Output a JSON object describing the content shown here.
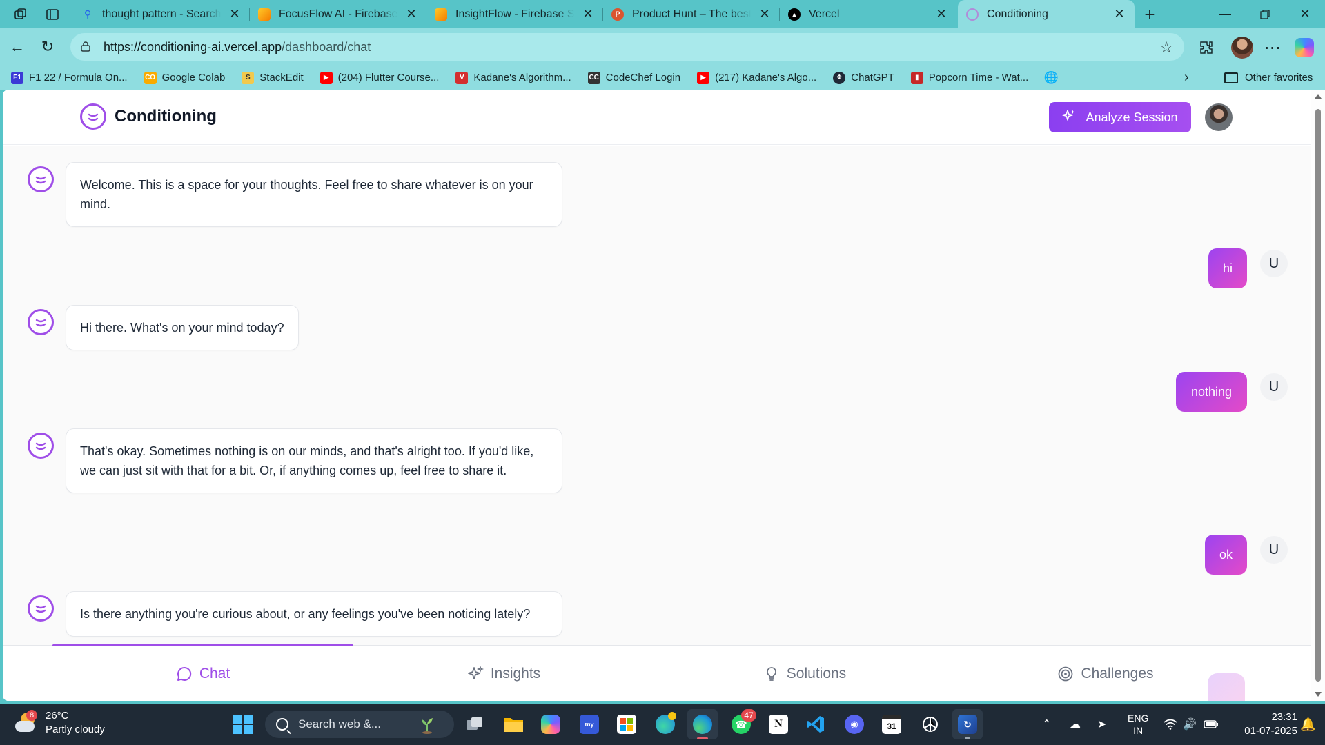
{
  "browser": {
    "tabs": [
      {
        "title": "thought pattern - Search",
        "icon": "search-icon",
        "color": "#2563eb"
      },
      {
        "title": "FocusFlow AI - Firebase Studio",
        "icon": "firebase-icon",
        "color": "#f5820d"
      },
      {
        "title": "InsightFlow - Firebase Studio",
        "icon": "firebase-icon",
        "color": "#f5820d"
      },
      {
        "title": "Product Hunt – The best new products",
        "icon": "producthunt-icon",
        "color": "#da552f"
      },
      {
        "title": "Vercel",
        "icon": "vercel-icon",
        "color": "#000000"
      },
      {
        "title": "Conditioning",
        "icon": "conditioning-favicon",
        "color": "#9f4ee8"
      }
    ],
    "url_host": "https://conditioning-ai.vercel.app",
    "url_path": "/dashboard/chat",
    "bookmarks": [
      {
        "label": "F1 22 / Formula On...",
        "icon": "f1-icon",
        "color": "#3b3bd6"
      },
      {
        "label": "Google Colab",
        "icon": "colab-icon",
        "color": "#f9ab00"
      },
      {
        "label": "StackEdit",
        "icon": "stackedit-icon",
        "color": "#f2c94c"
      },
      {
        "label": "(204) Flutter Course...",
        "icon": "youtube-icon",
        "color": "#ff0000"
      },
      {
        "label": "Kadane's Algorithm...",
        "icon": "vivaldi-icon",
        "color": "#d32f2f"
      },
      {
        "label": "CodeChef Login",
        "icon": "codechef-icon",
        "color": "#333333"
      },
      {
        "label": "(217) Kadane's Algo...",
        "icon": "youtube-icon",
        "color": "#ff0000"
      },
      {
        "label": "ChatGPT",
        "icon": "chatgpt-icon",
        "color": "#1f2937"
      },
      {
        "label": "Popcorn Time - Wat...",
        "icon": "popcorn-icon",
        "color": "#c62828"
      }
    ],
    "other_favorites": "Other favorites"
  },
  "app": {
    "brand": "Conditioning",
    "analyze_button": "Analyze Session",
    "accent": "#9f4ee8",
    "messages": [
      {
        "role": "bot",
        "text": "Welcome. This is a space for your thoughts. Feel free to share whatever is on your mind."
      },
      {
        "role": "user",
        "text": "hi",
        "initial": "U"
      },
      {
        "role": "bot",
        "text": "Hi there. What's on your mind today?"
      },
      {
        "role": "user",
        "text": "nothing",
        "initial": "U"
      },
      {
        "role": "bot",
        "text": "That's okay. Sometimes nothing is on our minds, and that's alright too. If you'd like, we can just sit with that for a bit. Or, if anything comes up, feel free to share it."
      },
      {
        "role": "user",
        "text": "ok",
        "initial": "U"
      },
      {
        "role": "bot",
        "text": "Is there anything you're curious about, or any feelings you've been noticing lately?"
      }
    ],
    "nav": [
      {
        "label": "Chat",
        "icon": "chat-bubble-icon",
        "active": true
      },
      {
        "label": "Insights",
        "icon": "sparkles-icon",
        "active": false
      },
      {
        "label": "Solutions",
        "icon": "lightbulb-icon",
        "active": false
      },
      {
        "label": "Challenges",
        "icon": "target-icon",
        "active": false
      }
    ]
  },
  "taskbar": {
    "weather_temp": "26°C",
    "weather_desc": "Partly cloudy",
    "weather_badge": "8",
    "search_placeholder": "Search web &...",
    "whatsapp_badge": "47",
    "calendar_day": "31",
    "lang_primary": "ENG",
    "lang_secondary": "IN",
    "time": "23:31",
    "date": "01-07-2025"
  }
}
